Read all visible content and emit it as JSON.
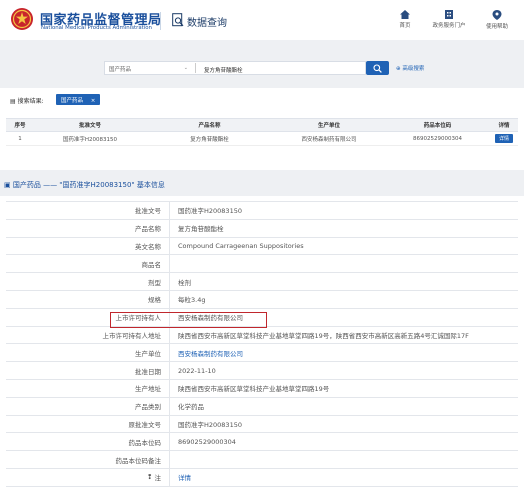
{
  "header": {
    "title": "国家药品监督管理局",
    "subtitle": "National Medical Products Administration",
    "section": "数据查询",
    "nav": [
      {
        "label": "首页",
        "icon": "home-icon"
      },
      {
        "label": "政务服务门户",
        "icon": "portal-icon"
      },
      {
        "label": "使用帮助",
        "icon": "help-icon"
      }
    ]
  },
  "search": {
    "category": "国产药品",
    "query": "复方角苷酸酯栓",
    "advanced_label": "高级搜索"
  },
  "results": {
    "label": "搜索结果:",
    "tag": "国产药品",
    "tag_close": "×",
    "columns": [
      "序号",
      "批准文号",
      "产品名称",
      "生产单位",
      "药品本位码",
      "详情"
    ],
    "rows": [
      {
        "index": "1",
        "approval_no": "国药准字H20083150",
        "product": "复方角苷酸酯栓",
        "manufacturer": "西安杨森制药有限公司",
        "drug_code": "86902529000304",
        "detail": "详情"
      }
    ]
  },
  "detail": {
    "title": "国产药品 —— \"国药准字H20083150\" 基本信息",
    "rows": [
      {
        "label": "批准文号",
        "value": "国药准字H20083150"
      },
      {
        "label": "产品名称",
        "value": "复方角苷酸酯栓"
      },
      {
        "label": "英文名称",
        "value": "Compound Carrageenan Suppositories"
      },
      {
        "label": "商品名",
        "value": ""
      },
      {
        "label": "剂型",
        "value": "栓剂"
      },
      {
        "label": "规格",
        "value": "每粒3.4g"
      },
      {
        "label": "上市许可持有人",
        "value": "西安杨森制药有限公司"
      },
      {
        "label": "上市许可持有人地址",
        "value": "陕西省西安市高新区草堂科技产业基地草堂四路19号，陕西省西安市高新区高新五路4号汇诚国际17F"
      },
      {
        "label": "生产单位",
        "value": "西安杨森制药有限公司",
        "link": true
      },
      {
        "label": "批准日期",
        "value": "2022-11-10"
      },
      {
        "label": "生产地址",
        "value": "陕西省西安市高新区草堂科技产业基地草堂四路19号"
      },
      {
        "label": "产品类别",
        "value": "化学药品"
      },
      {
        "label": "原批准文号",
        "value": "国药准字H20083150"
      },
      {
        "label": "药品本位码",
        "value": "86902529000304"
      },
      {
        "label": "药品本位码备注",
        "value": ""
      },
      {
        "label": "注",
        "value": "详情",
        "link": true
      }
    ]
  },
  "colors": {
    "brand_blue": "#1f62b5",
    "title_blue": "#1a4f9c",
    "highlight_red": "#c0272d",
    "band_gray": "#eef0f3"
  }
}
